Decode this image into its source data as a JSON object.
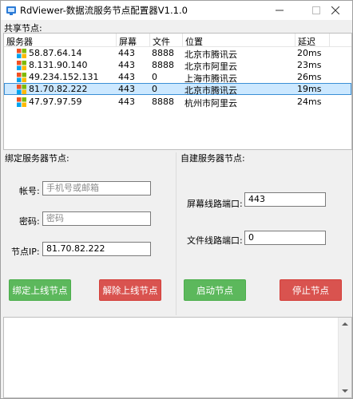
{
  "window": {
    "title": "RdViewer-数据流服务节点配置器V1.1.0",
    "icon": "app-icon",
    "controls": {
      "minimize": "—",
      "maximize": "☐",
      "close": "✕"
    }
  },
  "shared_nodes": {
    "label": "共享节点:",
    "columns": [
      "服务器",
      "屏幕",
      "文件",
      "位置",
      "延迟"
    ],
    "rows": [
      {
        "server": "58.87.64.14",
        "screen": "443",
        "file": "8888",
        "location": "北京市腾讯云",
        "latency": "20ms",
        "selected": false
      },
      {
        "server": "8.131.90.140",
        "screen": "443",
        "file": "8888",
        "location": "北京市阿里云",
        "latency": "23ms",
        "selected": false
      },
      {
        "server": "49.234.152.131",
        "screen": "443",
        "file": "0",
        "location": "上海市腾讯云",
        "latency": "26ms",
        "selected": false
      },
      {
        "server": "81.70.82.222",
        "screen": "443",
        "file": "0",
        "location": "北京市腾讯云",
        "latency": "19ms",
        "selected": true
      },
      {
        "server": "47.97.97.59",
        "screen": "443",
        "file": "8888",
        "location": "杭州市阿里云",
        "latency": "24ms",
        "selected": false
      }
    ]
  },
  "bind_panel": {
    "label": "绑定服务器节点:",
    "account_label": "帐号:",
    "account_placeholder": "手机号或邮箱",
    "password_label": "密码:",
    "password_placeholder": "密码",
    "node_ip_label": "节点IP:",
    "node_ip_value": "81.70.82.222",
    "bind_button": "绑定上线节点",
    "unbind_button": "解除上线节点"
  },
  "self_panel": {
    "label": "自建服务器节点:",
    "screen_port_label": "屏幕线路端口:",
    "screen_port_value": "443",
    "file_port_label": "文件线路端口:",
    "file_port_value": "0",
    "start_button": "启动节点",
    "stop_button": "停止节点"
  },
  "colors": {
    "green": "#5cb85c",
    "red": "#d9534f",
    "selection": "#cce8ff"
  }
}
